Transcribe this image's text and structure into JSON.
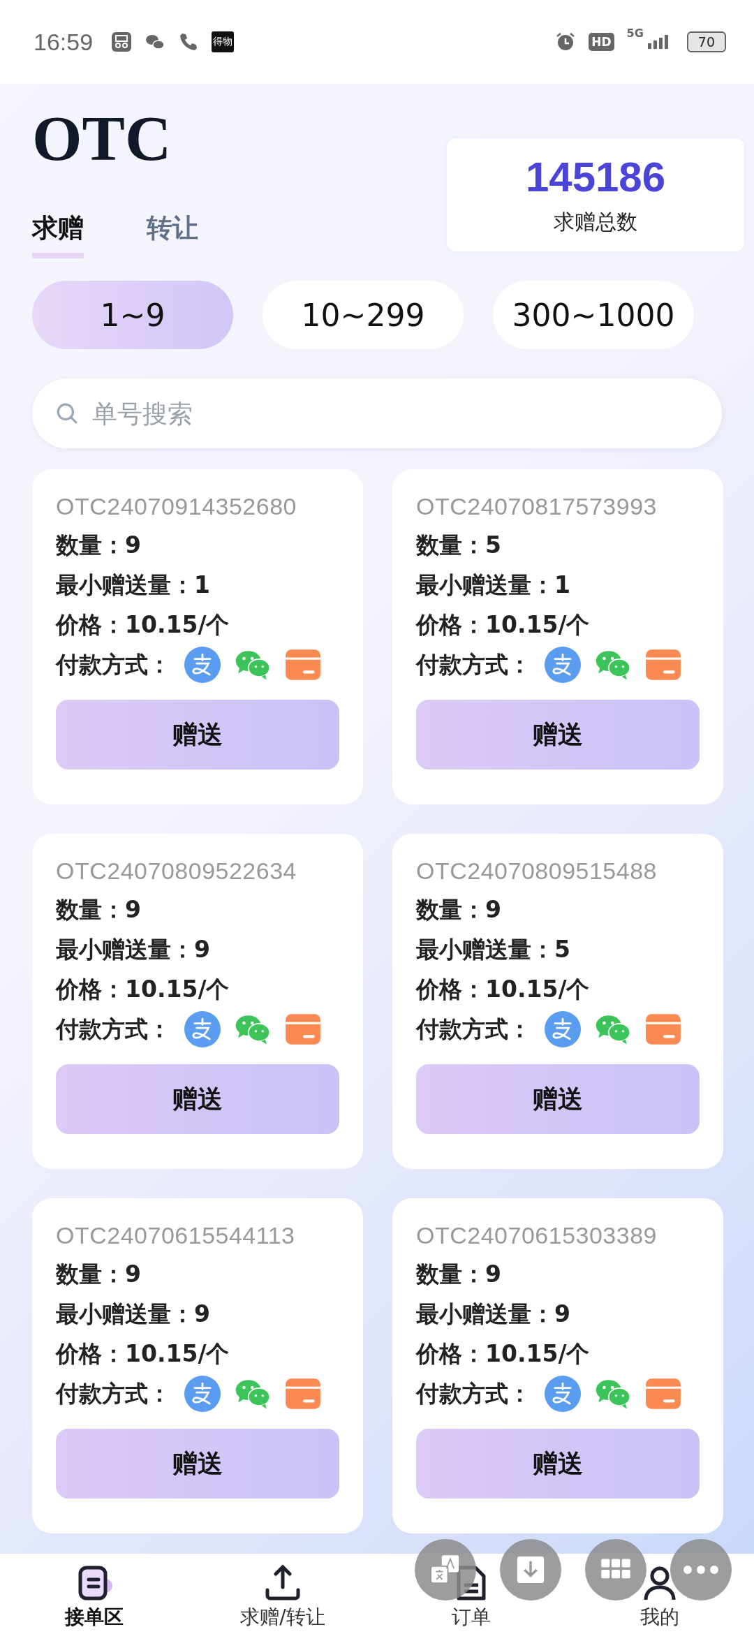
{
  "status_bar": {
    "time": "16:59",
    "app_badge": "得物",
    "hd": "HD",
    "network": "5G",
    "battery": "70"
  },
  "header": {
    "title": "OTC",
    "total_count": "145186",
    "total_label": "求赠总数"
  },
  "tabs": [
    {
      "label": "求赠",
      "selected": true
    },
    {
      "label": "转让",
      "selected": false
    }
  ],
  "ranges": [
    {
      "label": "1~9",
      "selected": true
    },
    {
      "label": "10~299",
      "selected": false
    },
    {
      "label": "300~1000",
      "selected": false
    }
  ],
  "search": {
    "placeholder": "单号搜索"
  },
  "orders": [
    {
      "order_no": "OTC24070914352680",
      "quantity": "数量：9",
      "min_amount": "最小赠送量：1",
      "price": "价格：10.15/个",
      "payment_label": "付款方式：",
      "button": "赠送"
    },
    {
      "order_no": "OTC24070817573993",
      "quantity": "数量：5",
      "min_amount": "最小赠送量：1",
      "price": "价格：10.15/个",
      "payment_label": "付款方式：",
      "button": "赠送"
    },
    {
      "order_no": "OTC24070809522634",
      "quantity": "数量：9",
      "min_amount": "最小赠送量：9",
      "price": "价格：10.15/个",
      "payment_label": "付款方式：",
      "button": "赠送"
    },
    {
      "order_no": "OTC24070809515488",
      "quantity": "数量：9",
      "min_amount": "最小赠送量：5",
      "price": "价格：10.15/个",
      "payment_label": "付款方式：",
      "button": "赠送"
    },
    {
      "order_no": "OTC24070615544113",
      "quantity": "数量：9",
      "min_amount": "最小赠送量：9",
      "price": "价格：10.15/个",
      "payment_label": "付款方式：",
      "button": "赠送"
    },
    {
      "order_no": "OTC24070615303389",
      "quantity": "数量：9",
      "min_amount": "最小赠送量：9",
      "price": "价格：10.15/个",
      "payment_label": "付款方式：",
      "button": "赠送"
    }
  ],
  "bottom_nav": [
    {
      "label": "接单区",
      "kind": "orders",
      "selected": true
    },
    {
      "label": "求赠/转让",
      "kind": "upload",
      "selected": false
    },
    {
      "label": "订单",
      "kind": "list",
      "selected": false
    },
    {
      "label": "我的",
      "kind": "profile",
      "selected": false
    }
  ]
}
